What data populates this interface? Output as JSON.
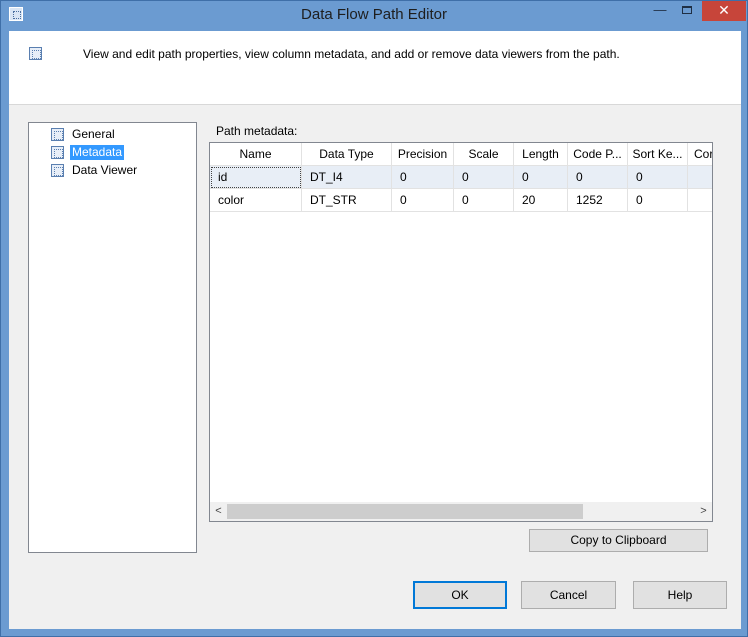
{
  "window": {
    "title": "Data Flow Path Editor",
    "minimize_glyph": "—",
    "close_glyph": "✕"
  },
  "header": {
    "description": "View and edit path properties, view column metadata, and add or remove data viewers from the path."
  },
  "nav": {
    "items": [
      {
        "label": "General",
        "selected": false
      },
      {
        "label": "Metadata",
        "selected": true
      },
      {
        "label": "Data Viewer",
        "selected": false
      }
    ]
  },
  "grid": {
    "label": "Path metadata:",
    "columns": [
      "Name",
      "Data Type",
      "Precision",
      "Scale",
      "Length",
      "Code P...",
      "Sort Ke...",
      "Cor"
    ],
    "rows": [
      [
        "id",
        "DT_I4",
        "0",
        "0",
        "0",
        "0",
        "0",
        ""
      ],
      [
        "color",
        "DT_STR",
        "0",
        "0",
        "20",
        "1252",
        "0",
        ""
      ]
    ]
  },
  "scrollbar": {
    "left_glyph": "<",
    "right_glyph": ">"
  },
  "buttons": {
    "copy": "Copy to Clipboard",
    "ok": "OK",
    "cancel": "Cancel",
    "help": "Help"
  },
  "colors": {
    "titlebar": "#6b9bd1",
    "close": "#c7453a",
    "selection": "#3399ff",
    "row_highlight": "#e8eef6"
  }
}
